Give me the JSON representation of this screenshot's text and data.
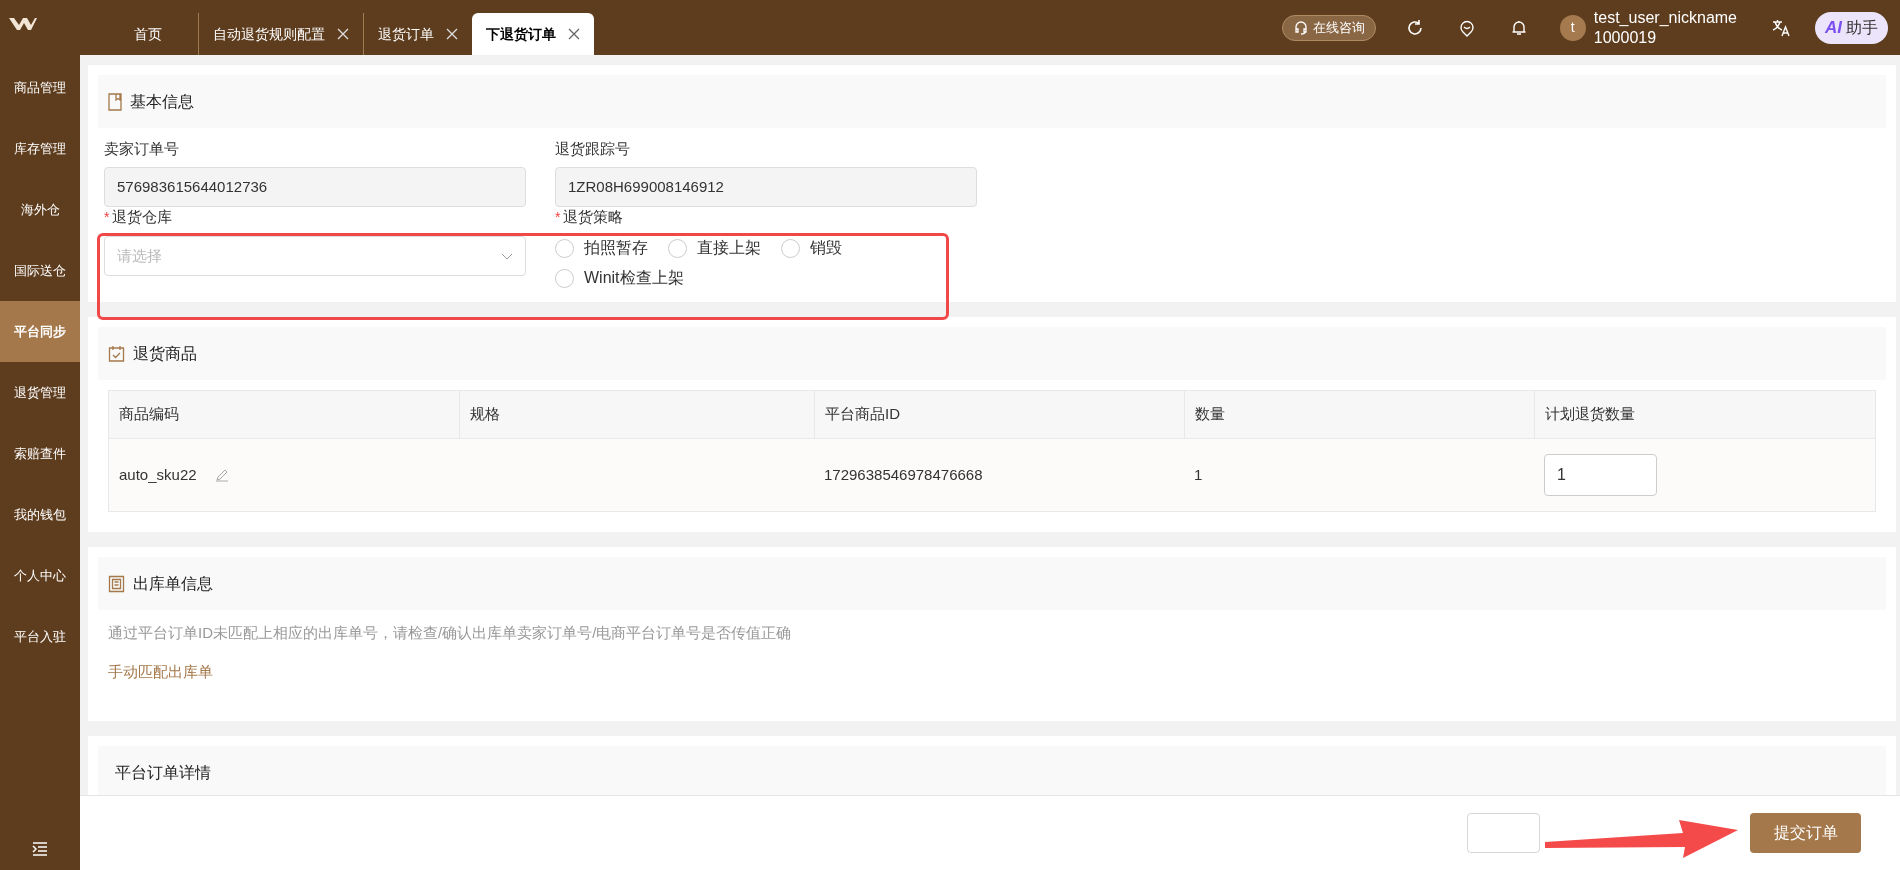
{
  "tabs": [
    {
      "label": "首页",
      "selected": false,
      "closable": false
    },
    {
      "label": "自动退货规则配置",
      "selected": false,
      "closable": true
    },
    {
      "label": "退货订单",
      "selected": false,
      "closable": true
    },
    {
      "label": "下退货订单",
      "selected": true,
      "closable": true
    }
  ],
  "header": {
    "consult_button": "在线咨询",
    "user": {
      "avatar_letter": "t",
      "nickname": "test_user_nickname",
      "id": "1000019"
    },
    "assistant_button": {
      "badge": "AI",
      "label": "助手"
    }
  },
  "sidebar": {
    "items": [
      {
        "label": "商品管理",
        "selected": false
      },
      {
        "label": "库存管理",
        "selected": false
      },
      {
        "label": "海外仓",
        "selected": false
      },
      {
        "label": "国际送仓",
        "selected": false
      },
      {
        "label": "平台同步",
        "selected": true
      },
      {
        "label": "退货管理",
        "selected": false
      },
      {
        "label": "索赔查件",
        "selected": false
      },
      {
        "label": "我的钱包",
        "selected": false
      },
      {
        "label": "个人中心",
        "selected": false
      },
      {
        "label": "平台入驻",
        "selected": false
      }
    ]
  },
  "basic_info": {
    "title": "基本信息",
    "fields": [
      {
        "label": "卖家订单号",
        "value": "576983615644012736"
      },
      {
        "label": "退货跟踪号",
        "value": "1ZR08H699008146912"
      }
    ],
    "warehouse": {
      "label": "退货仓库",
      "required_mark": "*",
      "placeholder": "请选择"
    },
    "strategy": {
      "label": "退货策略",
      "required_mark": "*",
      "options": [
        {
          "label": "拍照暂存",
          "selected": false
        },
        {
          "label": "直接上架",
          "selected": false
        },
        {
          "label": "销毁",
          "selected": false
        },
        {
          "label": "Winit检查上架",
          "selected": false
        }
      ]
    }
  },
  "return_items": {
    "title": "退货商品",
    "columns": [
      "商品编码",
      "规格",
      "平台商品ID",
      "数量",
      "计划退货数量"
    ],
    "rows": [
      {
        "sku": "auto_sku22",
        "platform_id": "1729638546978476668",
        "quantity": "1",
        "planned_quantity": "1"
      }
    ]
  },
  "outbound_info": {
    "title": "出库单信息",
    "message": "通过平台订单ID未匹配上相应的出库单号，请检查/确认出库单卖家订单号/电商平台订单号是否传值正确",
    "link": "手动匹配出库单"
  },
  "platform_order": {
    "title": "平台订单详情"
  },
  "footer": {
    "submit_button": "提交订单"
  }
}
